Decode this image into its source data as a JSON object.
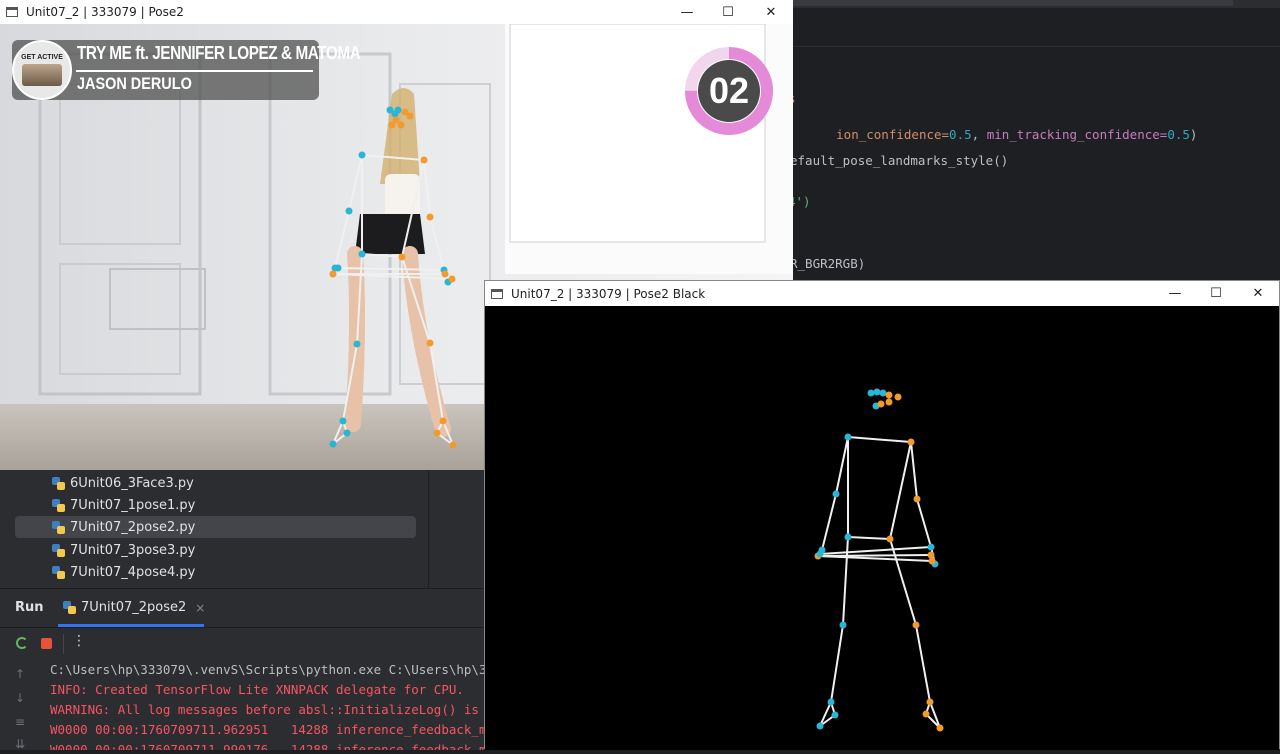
{
  "ide": {
    "code_lines": [
      {
        "segments": [
          {
            "t": "s",
            "c": "kw"
          }
        ]
      },
      {
        "segments": [
          {
            "t": "ion_confidence=",
            "c": "param"
          },
          {
            "t": "0.5",
            "c": "num"
          },
          {
            "t": ", ",
            "c": "txt"
          },
          {
            "t": "min_tracking_confidence=",
            "c": "param"
          },
          {
            "t": "0.5",
            "c": "num"
          },
          {
            "t": ")",
            "c": "txt"
          }
        ]
      },
      {
        "segments": [
          {
            "t": "efault_pose_landmarks_style()",
            "c": "txt"
          }
        ]
      },
      {
        "segments": [
          {
            "t": "4')",
            "c": "str"
          }
        ]
      },
      {
        "segments": [
          {
            "t": "R_BGR2RGB)",
            "c": "txt"
          }
        ]
      }
    ],
    "project_files": [
      "6Unit06_3Face3.py",
      "7Unit07_1pose1.py",
      "7Unit07_2pose2.py",
      "7Unit07_3pose3.py",
      "7Unit07_4pose4.py"
    ],
    "selected_file": "7Unit07_2pose2.py",
    "run": {
      "label": "Run",
      "tab": "7Unit07_2pose2",
      "close": "×",
      "more": "⋮",
      "console": [
        {
          "text": "C:\\Users\\hp\\333079\\.venvS\\Scripts\\python.exe C:\\Users\\hp\\3",
          "c": "white"
        },
        {
          "text": "INFO: Created TensorFlow Lite XNNPACK delegate for CPU.",
          "c": "red"
        },
        {
          "text": "WARNING: All log messages before absl::InitializeLog() is",
          "c": "red"
        },
        {
          "text": "W0000 00:00:1760709711.962951   14288 inference_feedback_m",
          "c": "red"
        },
        {
          "text": "W0000 00:00:1760709711.990176   14288 inference_feedback_m",
          "c": "red"
        }
      ]
    }
  },
  "pose2_window": {
    "title": "Unit07_2 | 333079 | Pose2",
    "minimize": "—",
    "maximize": "☐",
    "close": "✕",
    "song": {
      "logo_text": "GET ACTIVE",
      "title": "TRY ME ft. JENNIFER LOPEZ & MATOMA",
      "artist": "JASON DERULO"
    },
    "counter": "02",
    "counter_progress": 0.75
  },
  "black_window": {
    "title": "Unit07_2 | 333079 | Pose2 Black",
    "minimize": "—",
    "maximize": "☐",
    "close": "✕"
  },
  "colors": {
    "left_point": "#29b6d4",
    "right_point": "#f29a2e",
    "connection": "#f0f0f0",
    "counter_ring": "#e48ad8",
    "counter_bg": "#4a4a4a"
  }
}
